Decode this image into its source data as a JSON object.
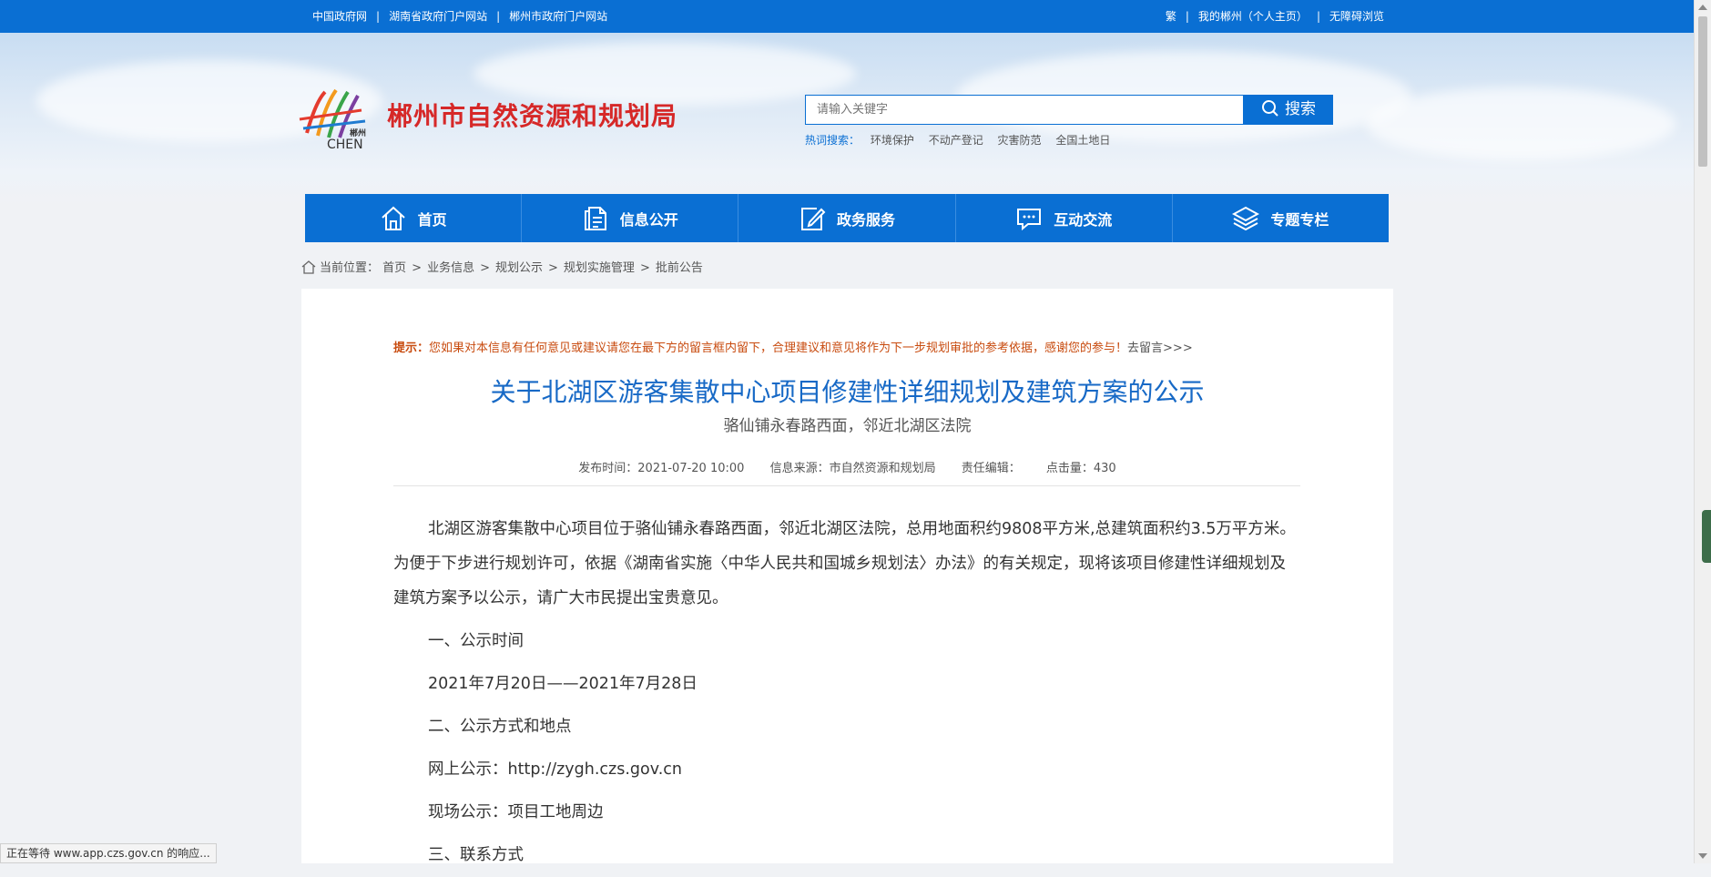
{
  "topbar": {
    "left_links": [
      "中国政府网",
      "湖南省政府门户网站",
      "郴州市政府门户网站"
    ],
    "right_links": [
      "繁",
      "我的郴州（个人主页）",
      "无障碍浏览"
    ]
  },
  "header": {
    "logo_text_top": "郴州",
    "logo_text_bottom": "CHEN",
    "site_name": "郴州市自然资源和规划局",
    "search": {
      "placeholder": "请输入关键字",
      "button_label": "搜索"
    },
    "hot_search": {
      "label": "热词搜索：",
      "items": [
        "环境保护",
        "不动产登记",
        "灾害防范",
        "全国土地日"
      ]
    }
  },
  "nav": {
    "items": [
      {
        "label": "首页",
        "icon": "home-icon"
      },
      {
        "label": "信息公开",
        "icon": "document-icon"
      },
      {
        "label": "政务服务",
        "icon": "edit-icon"
      },
      {
        "label": "互动交流",
        "icon": "chat-icon"
      },
      {
        "label": "专题专栏",
        "icon": "layers-icon"
      }
    ]
  },
  "breadcrumb": {
    "label": "当前位置：",
    "items": [
      "首页",
      "业务信息",
      "规划公示",
      "规划实施管理",
      "批前公告"
    ]
  },
  "article": {
    "tip_lead": "提示：",
    "tip_text": "您如果对本信息有任何意见或建议请您在最下方的留言框内留下，合理建议和意见将作为下一步规划审批的参考依据，感谢您的参与！",
    "tip_link": "去留言>>>",
    "title": "关于北湖区游客集散中心项目修建性详细规划及建筑方案的公示",
    "subtitle": "骆仙铺永春路西面，邻近北湖区法院",
    "meta": {
      "publish_time": "发布时间：2021-07-20 10:00",
      "source": "信息来源：市自然资源和规划局",
      "editor": "责任编辑：",
      "clicks": "点击量：430"
    },
    "paragraph": "北湖区游客集散中心项目位于骆仙铺永春路西面，邻近北湖区法院，总用地面积约9808平方米,总建筑面积约3.5万平方米。为便于下步进行规划许可，依据《湖南省实施〈中华人民共和国城乡规划法〉办法》的有关规定，现将该项目修建性详细规划及建筑方案予以公示，请广大市民提出宝贵意见。",
    "lines": [
      "一、公示时间",
      "2021年7月20日——2021年7月28日",
      "二、公示方式和地点",
      "网上公示：http://zygh.czs.gov.cn",
      "现场公示：项目工地周边",
      "三、联系方式"
    ]
  },
  "status_bar": "正在等待 www.app.czs.gov.cn 的响应..."
}
